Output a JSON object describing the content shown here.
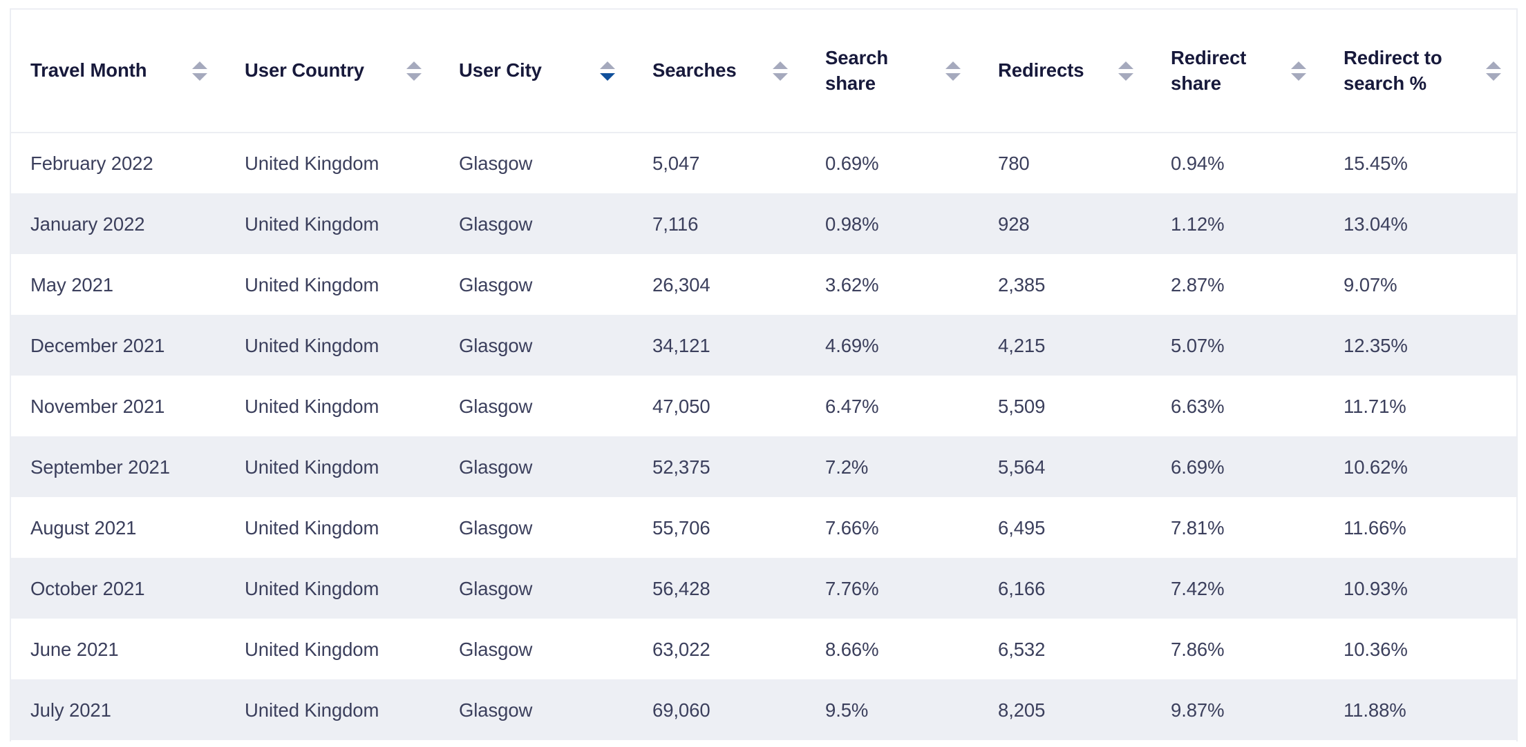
{
  "table": {
    "columns": [
      {
        "label": "Travel Month",
        "sort_icon": "sort-icon",
        "sort_state": "none"
      },
      {
        "label": "User Country",
        "sort_icon": "sort-icon",
        "sort_state": "none"
      },
      {
        "label": "User City",
        "sort_icon": "sort-icon",
        "sort_state": "desc"
      },
      {
        "label": "Searches",
        "sort_icon": "sort-icon",
        "sort_state": "none"
      },
      {
        "label": "Search share",
        "sort_icon": "sort-icon",
        "sort_state": "none"
      },
      {
        "label": "Redirects",
        "sort_icon": "sort-icon",
        "sort_state": "none"
      },
      {
        "label": "Redirect share",
        "sort_icon": "sort-icon",
        "sort_state": "none"
      },
      {
        "label": "Redirect to search %",
        "sort_icon": "sort-icon",
        "sort_state": "none"
      }
    ],
    "rows": [
      [
        "February 2022",
        "United Kingdom",
        "Glasgow",
        "5,047",
        "0.69%",
        "780",
        "0.94%",
        "15.45%"
      ],
      [
        "January 2022",
        "United Kingdom",
        "Glasgow",
        "7,116",
        "0.98%",
        "928",
        "1.12%",
        "13.04%"
      ],
      [
        "May 2021",
        "United Kingdom",
        "Glasgow",
        "26,304",
        "3.62%",
        "2,385",
        "2.87%",
        "9.07%"
      ],
      [
        "December 2021",
        "United Kingdom",
        "Glasgow",
        "34,121",
        "4.69%",
        "4,215",
        "5.07%",
        "12.35%"
      ],
      [
        "November 2021",
        "United Kingdom",
        "Glasgow",
        "47,050",
        "6.47%",
        "5,509",
        "6.63%",
        "11.71%"
      ],
      [
        "September 2021",
        "United Kingdom",
        "Glasgow",
        "52,375",
        "7.2%",
        "5,564",
        "6.69%",
        "10.62%"
      ],
      [
        "August 2021",
        "United Kingdom",
        "Glasgow",
        "55,706",
        "7.66%",
        "6,495",
        "7.81%",
        "11.66%"
      ],
      [
        "October 2021",
        "United Kingdom",
        "Glasgow",
        "56,428",
        "7.76%",
        "6,166",
        "7.42%",
        "10.93%"
      ],
      [
        "June 2021",
        "United Kingdom",
        "Glasgow",
        "63,022",
        "8.66%",
        "6,532",
        "7.86%",
        "10.36%"
      ],
      [
        "July 2021",
        "United Kingdom",
        "Glasgow",
        "69,060",
        "9.5%",
        "8,205",
        "9.87%",
        "11.88%"
      ]
    ]
  },
  "colors": {
    "header_text": "#17193b",
    "body_text": "#3b3f5c",
    "row_alt_bg": "#edeff4",
    "border": "#eceef3",
    "sort_inactive": "#a5a9bd",
    "sort_active": "#10509b"
  }
}
